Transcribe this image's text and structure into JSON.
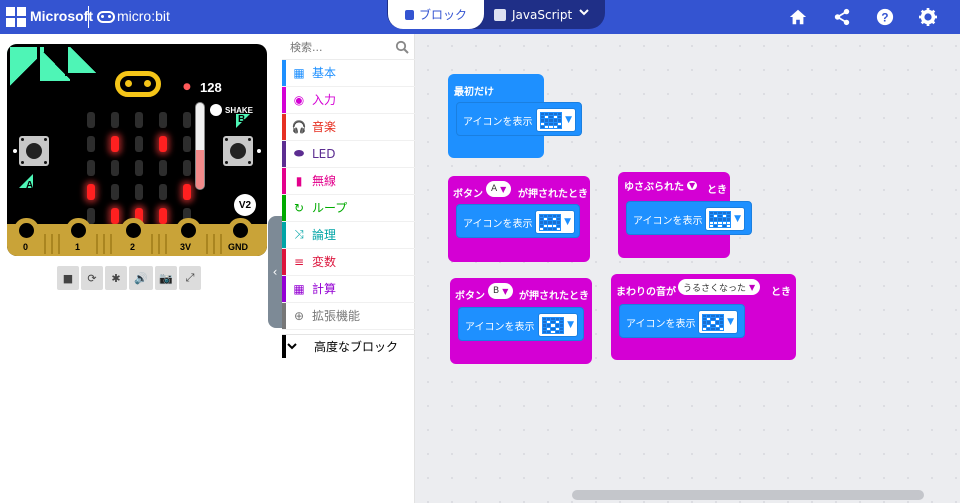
{
  "header": {
    "brand": "Microsoft",
    "product": "micro:bit",
    "mode_blocks_label": "ブロック",
    "mode_js_label": "JavaScript",
    "icons": [
      "home-icon",
      "share-icon",
      "help-icon",
      "settings-icon"
    ],
    "brand_color": "#3454d1"
  },
  "simulator": {
    "mic_level": "128",
    "shake_label": "SHAKE",
    "button_a": "A",
    "button_b": "B",
    "version_badge": "V2",
    "pins": [
      "0",
      "1",
      "2",
      "3V",
      "GND"
    ],
    "led_matrix": [
      [
        0,
        0,
        0,
        0,
        0
      ],
      [
        0,
        1,
        0,
        1,
        0
      ],
      [
        0,
        0,
        0,
        0,
        0
      ],
      [
        1,
        0,
        0,
        0,
        1
      ],
      [
        0,
        1,
        1,
        1,
        0
      ]
    ],
    "light_level_fraction": 0.45,
    "toolbar": {
      "stop": "■",
      "restart": "⟳",
      "debug": "✱",
      "mute": "🔊",
      "screenshot": "📷",
      "fullscreen": "⤢"
    }
  },
  "toolbox": {
    "search_placeholder": "検索...",
    "categories": [
      {
        "label": "基本",
        "color": "#1e90ff",
        "icon": "▦"
      },
      {
        "label": "入力",
        "color": "#d400d4",
        "icon": "◉"
      },
      {
        "label": "音楽",
        "color": "#e63022",
        "icon": "🎧"
      },
      {
        "label": "LED",
        "color": "#5c2d91",
        "icon": "⬬"
      },
      {
        "label": "無線",
        "color": "#e3008c",
        "icon": "▮"
      },
      {
        "label": "ループ",
        "color": "#00aa00",
        "icon": "↻"
      },
      {
        "label": "論理",
        "color": "#00a4a6",
        "icon": "⤨"
      },
      {
        "label": "変数",
        "color": "#dc143c",
        "icon": "≡"
      },
      {
        "label": "計算",
        "color": "#9400d3",
        "icon": "▦"
      },
      {
        "label": "拡張機能",
        "color": "#777777",
        "icon": "⊕"
      }
    ],
    "advanced_label": "高度なブロック"
  },
  "workspace": {
    "blocks": [
      {
        "event": "最初だけ",
        "statement": "アイコンを表示",
        "icon": [
          [
            0,
            0,
            0,
            0,
            0
          ],
          [
            0,
            1,
            0,
            1,
            0
          ],
          [
            0,
            0,
            0,
            0,
            0
          ],
          [
            1,
            0,
            0,
            0,
            1
          ],
          [
            0,
            1,
            1,
            1,
            0
          ]
        ]
      },
      {
        "event_prefix": "ボタン",
        "event_field": "A",
        "event_suffix": "が押されたとき",
        "statement": "アイコンを表示",
        "icon": [
          [
            0,
            0,
            0,
            0,
            0
          ],
          [
            0,
            1,
            0,
            1,
            0
          ],
          [
            0,
            0,
            0,
            0,
            0
          ],
          [
            0,
            1,
            1,
            1,
            0
          ],
          [
            1,
            0,
            0,
            0,
            1
          ]
        ]
      },
      {
        "event_field": "ゆさぶられた",
        "event_suffix": "とき",
        "statement": "アイコンを表示",
        "icon": [
          [
            0,
            0,
            0,
            0,
            0
          ],
          [
            0,
            1,
            0,
            1,
            0
          ],
          [
            0,
            0,
            0,
            0,
            0
          ],
          [
            1,
            1,
            1,
            1,
            1
          ],
          [
            1,
            0,
            1,
            0,
            1
          ]
        ]
      },
      {
        "event_prefix": "ボタン",
        "event_field": "B",
        "event_suffix": "が押されたとき",
        "statement": "アイコンを表示",
        "icon": [
          [
            0,
            0,
            0,
            0,
            0
          ],
          [
            0,
            1,
            0,
            1,
            0
          ],
          [
            0,
            0,
            1,
            0,
            0
          ],
          [
            0,
            1,
            0,
            1,
            0
          ],
          [
            0,
            0,
            1,
            0,
            0
          ]
        ]
      },
      {
        "event_prefix": "まわりの音が",
        "event_field": "うるさくなった",
        "event_suffix": "とき",
        "statement": "アイコンを表示",
        "icon": [
          [
            0,
            0,
            0,
            0,
            0
          ],
          [
            0,
            1,
            0,
            1,
            0
          ],
          [
            0,
            0,
            1,
            0,
            0
          ],
          [
            0,
            1,
            0,
            1,
            0
          ],
          [
            1,
            0,
            0,
            0,
            1
          ]
        ]
      }
    ],
    "input_block_color": "#d400d4",
    "basic_block_color": "#1e90ff"
  }
}
